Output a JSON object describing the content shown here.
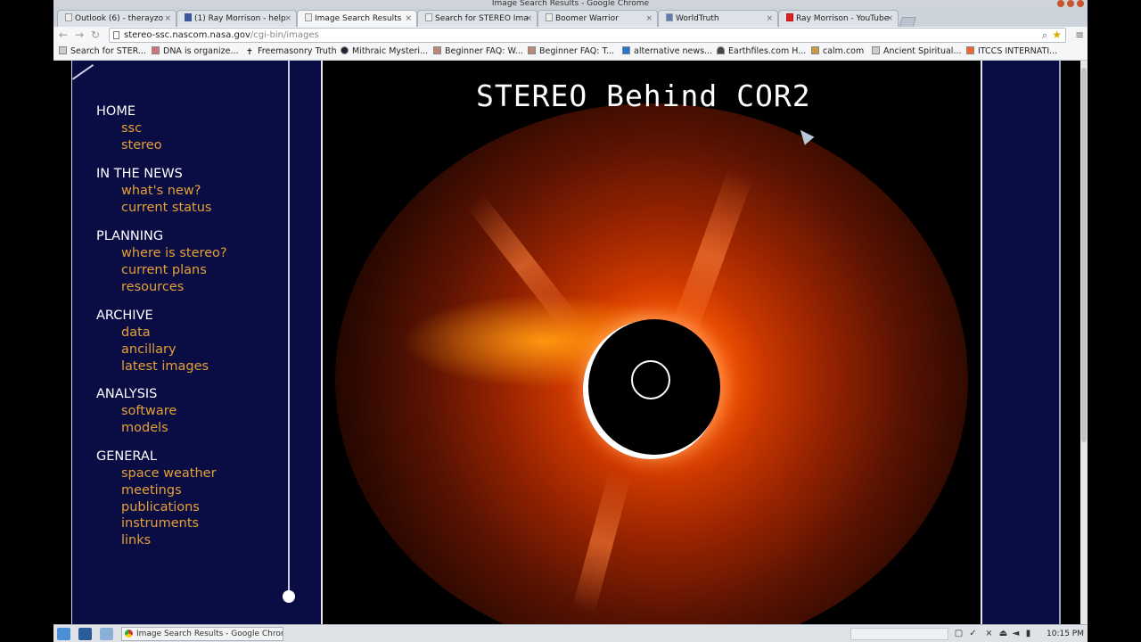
{
  "window": {
    "title": "Image Search Results - Google Chrome"
  },
  "tabs": [
    {
      "label": "Outlook (6) - therayzo"
    },
    {
      "label": "(1) Ray Morrison - help"
    },
    {
      "label": "Image Search Results"
    },
    {
      "label": "Search for STEREO Ima"
    },
    {
      "label": "Boomer Warrior"
    },
    {
      "label": "WorldTruth"
    },
    {
      "label": "Ray Morrison - YouTube"
    }
  ],
  "toolbar": {
    "url_host": "stereo-ssc.nascom.nasa.gov",
    "url_path": "/cgi-bin/images"
  },
  "bookmarks": [
    {
      "label": "Search for STER..."
    },
    {
      "label": "DNA is organize..."
    },
    {
      "label": "Freemasonry Truth"
    },
    {
      "label": "Mithraic Mysteri..."
    },
    {
      "label": "Beginner FAQ: W..."
    },
    {
      "label": "Beginner FAQ: T..."
    },
    {
      "label": "alternative news..."
    },
    {
      "label": "Earthfiles.com H..."
    },
    {
      "label": "calm.com"
    },
    {
      "label": "Ancient Spiritual..."
    },
    {
      "label": "ITCCS INTERNATI..."
    }
  ],
  "nav": {
    "sections": [
      {
        "heading": "HOME",
        "links": [
          "ssc",
          "stereo"
        ]
      },
      {
        "heading": "IN THE NEWS",
        "links": [
          "what's new?",
          "current status"
        ]
      },
      {
        "heading": "PLANNING",
        "links": [
          "where is stereo?",
          "current plans",
          "resources"
        ]
      },
      {
        "heading": "ARCHIVE",
        "links": [
          "data",
          "ancillary",
          "latest images"
        ]
      },
      {
        "heading": "ANALYSIS",
        "links": [
          "software",
          "models"
        ]
      },
      {
        "heading": "GENERAL",
        "links": [
          "space weather",
          "meetings",
          "publications",
          "instruments",
          "links"
        ]
      }
    ]
  },
  "image": {
    "title": "STEREO Behind COR2"
  },
  "taskbar": {
    "task_label": "Image Search Results - Google Chrome",
    "clock": "10:15 PM"
  },
  "colors": {
    "nav_bg": "#0a0c44",
    "nav_link": "#e5a036",
    "nav_heading": "#ffffff"
  }
}
